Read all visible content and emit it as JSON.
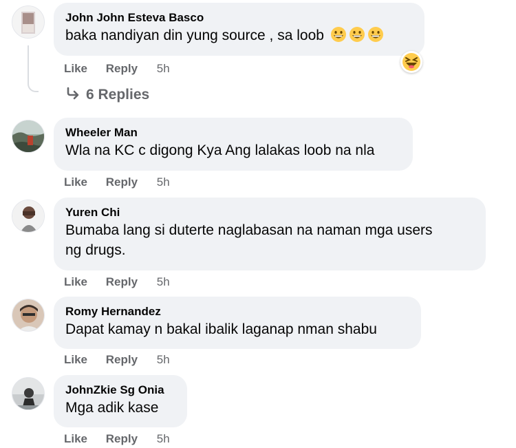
{
  "comments": [
    {
      "author": "John John Esteva Basco",
      "text": "baka nandiyan din yung source , sa loob",
      "emoji_icons": [
        "grinning-face-icon",
        "grinning-face-icon",
        "grinning-face-icon"
      ],
      "reaction_icon": "laughing-face-icon",
      "like": "Like",
      "reply": "Reply",
      "time": "5h",
      "replies_count": "6 Replies"
    },
    {
      "author": "Wheeler Man",
      "text": "Wla na KC c digong Kya Ang lalakas loob na nla",
      "like": "Like",
      "reply": "Reply",
      "time": "5h"
    },
    {
      "author": "Yuren Chi",
      "text_line1": "Bumaba lang si duterte naglabasan na naman mga users",
      "text_line2": "ng drugs.",
      "like": "Like",
      "reply": "Reply",
      "time": "5h"
    },
    {
      "author": "Romy Hernandez",
      "text": "Dapat kamay n bakal ibalik laganap nman shabu",
      "like": "Like",
      "reply": "Reply",
      "time": "5h"
    },
    {
      "author": "JohnZkie Sg Onia",
      "text": "Mga adik kase",
      "like": "Like",
      "reply": "Reply",
      "time": "5h"
    }
  ],
  "colors": {
    "bubble": "#f0f2f5",
    "secondary_text": "#65676b",
    "primary_text": "#050505",
    "emoji_yellow": "#ffcc4d"
  }
}
